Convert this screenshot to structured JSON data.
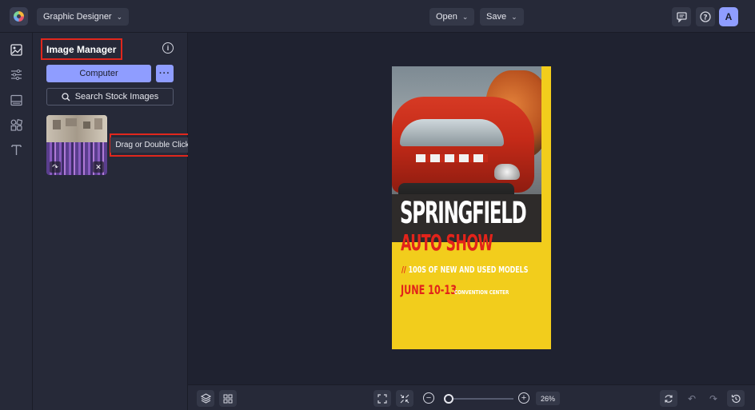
{
  "header": {
    "app_menu_label": "Graphic Designer",
    "open_label": "Open",
    "save_label": "Save",
    "avatar_initial": "A"
  },
  "panel": {
    "title": "Image Manager",
    "computer_button": "Computer",
    "more_button": "···",
    "search_button": "Search Stock Images",
    "tooltip": "Drag or Double Click"
  },
  "poster": {
    "title": "SPRINGFIELD",
    "subtitle": "AUTO SHOW",
    "line1_marker": "//",
    "line1": "100S OF NEW AND USED MODELS",
    "date": "JUNE 10-13",
    "venue": "CONVENTION CENTER"
  },
  "bottom": {
    "zoom_value": "26%",
    "zoom_level": 0.05
  },
  "colors": {
    "accent": "#8f9dff",
    "highlight": "#e0271d",
    "poster_yellow": "#f2cd1c",
    "poster_red": "#e2231a"
  },
  "icons": {
    "rail": [
      "image-icon",
      "sliders-icon",
      "layout-icon",
      "shapes-icon",
      "text-icon"
    ],
    "header": [
      "comment-icon",
      "help-icon"
    ],
    "bottom": [
      "layers-icon",
      "grid-icon",
      "fit-screen-icon",
      "shrink-icon",
      "zoom-out-icon",
      "zoom-in-icon",
      "sync-icon",
      "undo-icon",
      "redo-icon",
      "history-icon"
    ]
  }
}
